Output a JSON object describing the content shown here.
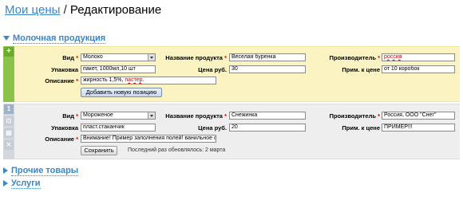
{
  "breadcrumb": {
    "link": "Мои цены",
    "separator": "/",
    "current": "Редактирование"
  },
  "sections": {
    "dairy": "Молочная продукция",
    "other": "Прочие товары",
    "services": "Услуги"
  },
  "labels": {
    "kind": "Вид",
    "product_name": "Название продукта",
    "producer": "Производитель",
    "package": "Упаковка",
    "price": "Цена руб.",
    "price_note": "Прим. к цене",
    "description": "Описание",
    "required_mark": "*"
  },
  "new_item": {
    "kind": "Молоко",
    "product_name": "Веселая буренка",
    "producer": "россия",
    "package": "пакет, 1000мл,10 шт",
    "price": "30",
    "price_note": "от 10 коробок",
    "description_a": "жирность 1,5%, ",
    "description_b": "пастер",
    "description_c": ".",
    "add_button": "Добавить новую позицию",
    "add_icon": "plus-icon"
  },
  "item_1": {
    "number": "1",
    "kind": "Мороженое",
    "product_name": "Снежинка",
    "producer": "Россия, ООО \"Снег\"",
    "package": "пласт.стаканчик",
    "price": "20",
    "price_note": "ПРИМЕР!!!",
    "description": "Внимание! Пример заполнения полей! ванильное с н",
    "save_button": "Сохранить",
    "last_updated": "Последний раз обновлялось: 2 марта"
  },
  "colors": {
    "link": "#3a86c8",
    "new_item_bg": "#fbf4c2",
    "existing_item_bg": "#eeeeee",
    "add_strip": "#8bc34a",
    "required": "#dd0000"
  }
}
